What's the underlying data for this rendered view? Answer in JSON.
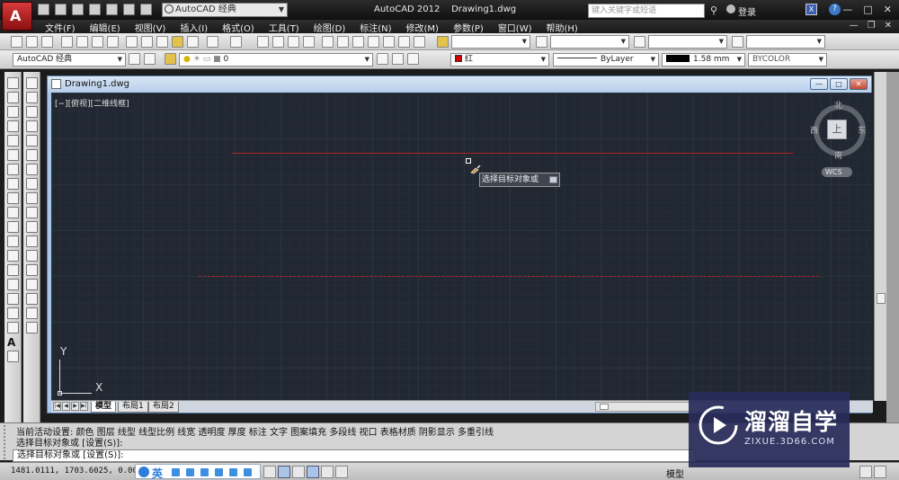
{
  "title_bar": {
    "app_name": "AutoCAD 2012",
    "document": "Drawing1.dwg",
    "workspace": "AutoCAD 经典",
    "search_placeholder": "键入关键字或短语",
    "login_label": "登录",
    "window_controls": [
      "minimize-icon",
      "maximize-icon",
      "close-icon"
    ]
  },
  "menu_bar": {
    "items": [
      "文件(F)",
      "编辑(E)",
      "视图(V)",
      "插入(I)",
      "格式(O)",
      "工具(T)",
      "绘图(D)",
      "标注(N)",
      "修改(M)",
      "参数(P)",
      "窗口(W)",
      "帮助(H)"
    ]
  },
  "toolbar_row2": {
    "workspace": "AutoCAD 经典",
    "layer_name": "0",
    "color": "红",
    "color_hex": "#cc0000",
    "linetype": "ByLayer",
    "lineweight": "1.58 mm",
    "plot_style": "BYCOLOR"
  },
  "drawing_window": {
    "title": "Drawing1.dwg",
    "viewport_label": "[−][俯视][二维线框]"
  },
  "canvas": {
    "background": "#212832",
    "line_color": "#b42424",
    "tooltip": "选择目标对象或",
    "ucs_x": "X",
    "ucs_y": "Y"
  },
  "viewcube": {
    "north": "北",
    "south": "南",
    "east": "东",
    "west": "西",
    "top_face": "上",
    "wcs_label": "WCS"
  },
  "layout_tabs": [
    "模型",
    "布局1",
    "布局2"
  ],
  "command": {
    "history": [
      "当前活动设置:  颜色 图层 线型 线型比例 线宽 透明度 厚度 标注 文字 图案填充 多段线 视口 表格材质 阴影显示 多重引线",
      "选择目标对象或 [设置(S)]:"
    ],
    "prompt": "选择目标对象或 [设置(S)]:"
  },
  "status_bar": {
    "coordinates": "1481.0111, 1703.6025, 0.0000",
    "ime_lang": "英",
    "model_label": "模型"
  },
  "watermark": {
    "title": "溜溜自学",
    "subtitle": "ZIXUE.3D66.COM"
  }
}
